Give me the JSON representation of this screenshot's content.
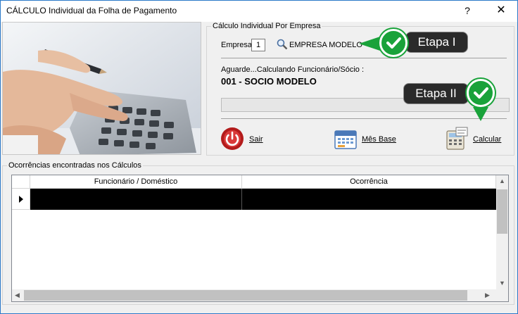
{
  "window": {
    "title": "CÁLCULO Individual da Folha de Pagamento",
    "help": "?",
    "close": "✕"
  },
  "empresa": {
    "group_title": "Cálculo Individual Por Empresa",
    "label": "Empresa",
    "value": "1",
    "name": "EMPRESA MODELO",
    "status": "Aguarde...Calculando Funcionário/Sócio :",
    "current": "001 - SOCIO MODELO"
  },
  "actions": {
    "sair": "Sair",
    "mes_base": "Mês Base",
    "calcular": "Calcular"
  },
  "ocorrencias": {
    "group_title": "Ocorrências encontradas nos Cálculos",
    "columns": [
      "Funcionário  / Doméstico",
      "Ocorrência"
    ]
  },
  "callouts": {
    "step1": "Etapa I",
    "step2": "Etapa II"
  },
  "colors": {
    "accent": "#2b79c9",
    "callout_bg": "#2a2a2a",
    "check_green": "#19a23a",
    "selected_row": "#000000"
  }
}
